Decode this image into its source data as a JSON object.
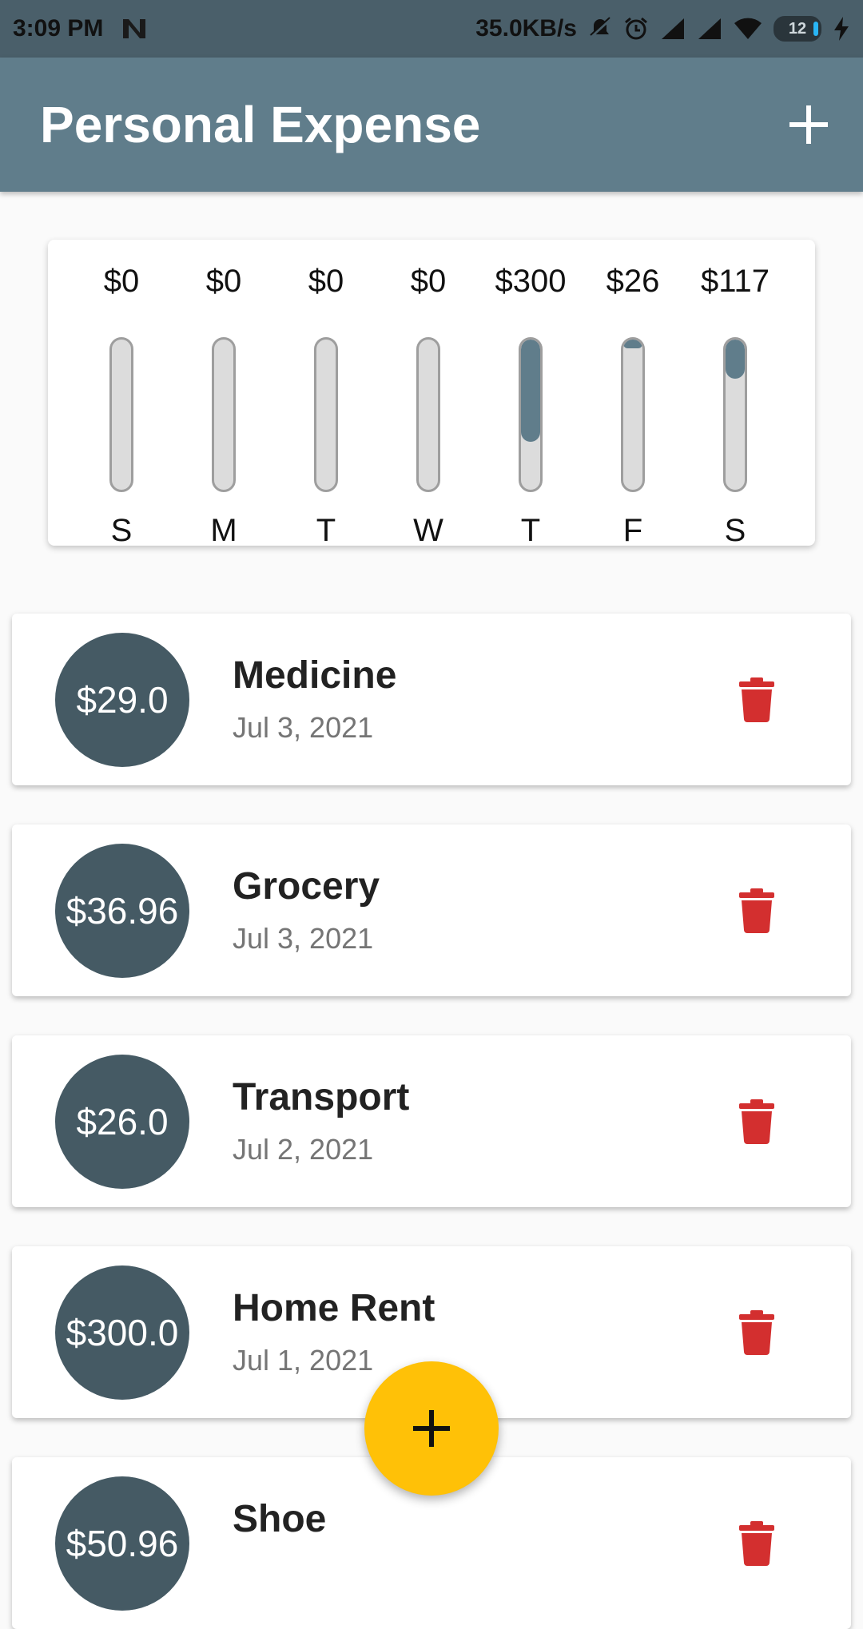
{
  "status_bar": {
    "time": "3:09 PM",
    "network_speed": "35.0KB/s",
    "battery_level": "12",
    "icons": [
      "n-icon",
      "mute-icon",
      "alarm-icon",
      "signal-icon",
      "signal-icon",
      "wifi-icon",
      "battery-icon",
      "charging-icon"
    ]
  },
  "app_bar": {
    "title": "Personal Expense",
    "add_icon": "plus-icon"
  },
  "weekly_chart": {
    "bars": [
      {
        "day": "S",
        "amount_label": "$0",
        "fill_fraction": 0
      },
      {
        "day": "M",
        "amount_label": "$0",
        "fill_fraction": 0
      },
      {
        "day": "T",
        "amount_label": "$0",
        "fill_fraction": 0
      },
      {
        "day": "W",
        "amount_label": "$0",
        "fill_fraction": 0
      },
      {
        "day": "T",
        "amount_label": "$300",
        "fill_fraction": 0.68
      },
      {
        "day": "F",
        "amount_label": "$26",
        "fill_fraction": 0.06
      },
      {
        "day": "S",
        "amount_label": "$117",
        "fill_fraction": 0.26
      }
    ]
  },
  "transactions": [
    {
      "amount": "$29.0",
      "title": "Medicine",
      "date": "Jul 3, 2021"
    },
    {
      "amount": "$36.96",
      "title": "Grocery",
      "date": "Jul 3, 2021"
    },
    {
      "amount": "$26.0",
      "title": "Transport",
      "date": "Jul 2, 2021"
    },
    {
      "amount": "$300.0",
      "title": "Home Rent",
      "date": "Jul 1, 2021"
    },
    {
      "amount": "$50.96",
      "title": "Shoe",
      "date": ""
    }
  ],
  "colors": {
    "primary": "#607d8b",
    "avatar": "#455a64",
    "delete": "#d32f2f",
    "fab": "#ffc107"
  },
  "fab_icon": "plus-icon"
}
